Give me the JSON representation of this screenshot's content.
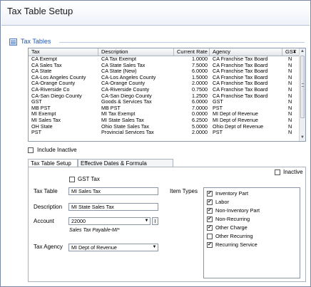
{
  "window": {
    "title": "Tax Table Setup"
  },
  "section": {
    "title": "Tax Tables"
  },
  "grid": {
    "columns": [
      "Tax",
      "Description",
      "Current Rate",
      "Agency",
      "GST"
    ],
    "rows": [
      [
        "CA Exempt",
        "CA Tax Exempt",
        "1.0000",
        "CA Franchise Tax Board",
        "N"
      ],
      [
        "CA Sales Tax",
        "CA State Sales Tax",
        "7.5000",
        "CA Franchise Tax Board",
        "N"
      ],
      [
        "CA State",
        "CA State (New)",
        "6.0000",
        "CA Franchise Tax Board",
        "N"
      ],
      [
        "CA-Los Angeles County",
        "CA-Los Angeles County",
        "1.5000",
        "CA Franchise Tax Board",
        "N"
      ],
      [
        "CA-Orange County",
        "CA-Orange County",
        "2.0000",
        "CA Franchise Tax Board",
        "N"
      ],
      [
        "CA-Riverside Co",
        "CA-Riverside County",
        "0.7500",
        "CA Franchise Tax Board",
        "N"
      ],
      [
        "CA-San Diego County",
        "CA-San Diego County",
        "1.2500",
        "CA Franchise Tax Board",
        "N"
      ],
      [
        "GST",
        "Goods & Services Tax",
        "6.0000",
        "GST",
        "N"
      ],
      [
        "MB PST",
        "MB PST",
        "7.0000",
        "PST",
        "N"
      ],
      [
        "MI Exempt",
        "MI Tax Exempt",
        "0.0000",
        "MI Dept of Revenue",
        "N"
      ],
      [
        "MI Sales Tax",
        "MI State Sales Tax",
        "6.2500",
        "MI Dept of Revenue",
        "N"
      ],
      [
        "OH State",
        "Ohio State Sales Tax",
        "5.0000",
        "Ohio Dept of Revenue",
        "N"
      ],
      [
        "PST",
        "Provincial Services Tax",
        "2.0000",
        "PST",
        "N"
      ]
    ]
  },
  "include_inactive_label": "Include Inactive",
  "tabs": [
    "Tax Table Setup",
    "Effective Dates & Formula"
  ],
  "form": {
    "gst_label": "GST Tax",
    "inactive_label": "Inactive",
    "tax_table_label": "Tax Table",
    "tax_table_value": "MI Sales Tax",
    "description_label": "Description",
    "description_value": "MI State Sales Tax",
    "account_label": "Account",
    "account_value": "22000",
    "account_desc": "Sales Tax Payable-MI*",
    "tax_agency_label": "Tax Agency",
    "tax_agency_value": "MI Dept of Revenue",
    "item_types_label": "Item Types"
  },
  "item_types": [
    {
      "label": "Inventory Part",
      "checked": true
    },
    {
      "label": "Labor",
      "checked": true
    },
    {
      "label": "Non-Inventory Part",
      "checked": true
    },
    {
      "label": "Non-Recurring",
      "checked": true
    },
    {
      "label": "Other Charge",
      "checked": true
    },
    {
      "label": "Other Recurring",
      "checked": false
    },
    {
      "label": "Recurring Service",
      "checked": true
    }
  ],
  "colors": {
    "accent": "#1f56a8",
    "border": "#8c9bb3"
  }
}
